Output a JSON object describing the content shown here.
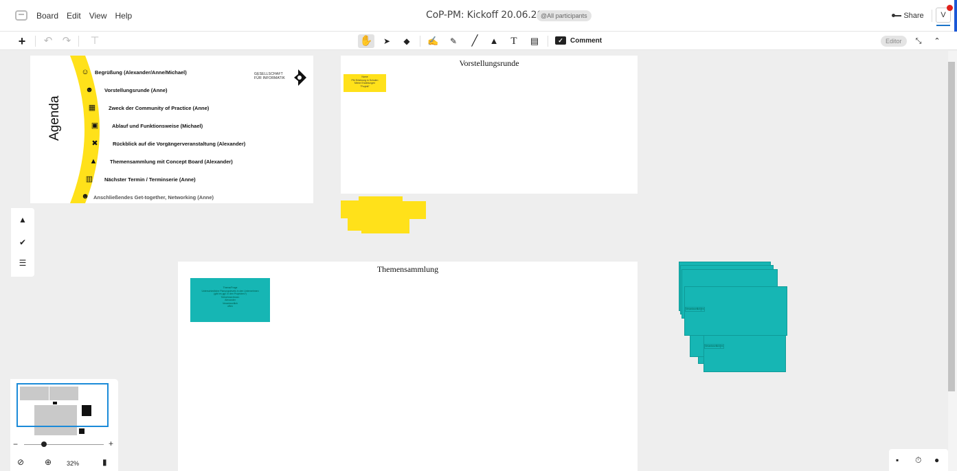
{
  "app": {
    "menu": [
      "Board",
      "Edit",
      "View",
      "Help"
    ],
    "board_title": "CoP-PM: Kickoff 20.06.2023",
    "participants_label": "@All participants",
    "share_label": "Share",
    "avatar_initial": "V",
    "editor_label": "Editor"
  },
  "toolbar": {
    "comment_label": "Comment"
  },
  "agenda": {
    "word": "Agenda",
    "items": [
      "Begrüßung (Alexander/Anne/Michael)",
      "Vorstellungsrunde (Anne)",
      "Zweck der Community of Practice (Anne)",
      "Ablauf und Funktionsweise (Michael)",
      "Rückblick auf die Vorgängerveranstaltung (Alexander)",
      "Themensammlung mit Concept Board (Alexander)",
      "Nächster Termin / Terminserie (Anne)",
      "Anschließendes Get-together, Networking (Anne)"
    ],
    "gi_line1": "GESELLSCHAFT",
    "gi_line2": "FÜR INFORMATIK",
    "accent_color": "#ffe11a"
  },
  "frames": {
    "vorstellung_title": "Vorstellungsrunde",
    "vorstellung_note": [
      "Name",
      "PM Erfahrung in Schulen",
      "Meine Erwartungen",
      "\"Projekt\""
    ],
    "thema_title": "Themensammlung",
    "thema_note": [
      "Thema/Frage",
      "Unterschiedliche Planungslevels in den Unternehmen",
      "(gibt es ggf. in den Projekten?)",
      "Teilnehmer/innen",
      "Alexander",
      "Verantwortlich",
      "offen"
    ]
  },
  "stack_notes": {
    "note_a": [
      "Thema/Frage",
      "Teilnehmer/innen",
      "Verantwortlich"
    ],
    "note_b": [
      "Thema/Frage",
      "Teilnehmer/innen",
      "Verantwortlich"
    ],
    "color": "#16b6b4"
  },
  "minimap": {
    "zoom_level": "32%"
  },
  "icons": {
    "menu_logo": "board-logo-icon",
    "undo": "undo-icon",
    "redo": "redo-icon",
    "format_painter": "format-painter-icon",
    "hand": "hand-icon",
    "pointer": "pointer-icon",
    "eraser": "eraser-icon",
    "pen": "pen-icon",
    "marker": "marker-icon",
    "line": "line-icon",
    "shapes": "shapes-icon",
    "text": "text-icon",
    "sticky": "sticky-note-icon",
    "comment": "comment-icon",
    "expand": "expand-icon",
    "collapse": "collapse-icon",
    "bell": "bell-icon",
    "check": "check-icon",
    "list": "list-icon",
    "compass": "compass-icon",
    "zoom": "zoom-icon",
    "mouse": "mouse-icon",
    "presenter": "presenter-icon",
    "timer": "timer-icon",
    "chat": "chat-icon"
  }
}
